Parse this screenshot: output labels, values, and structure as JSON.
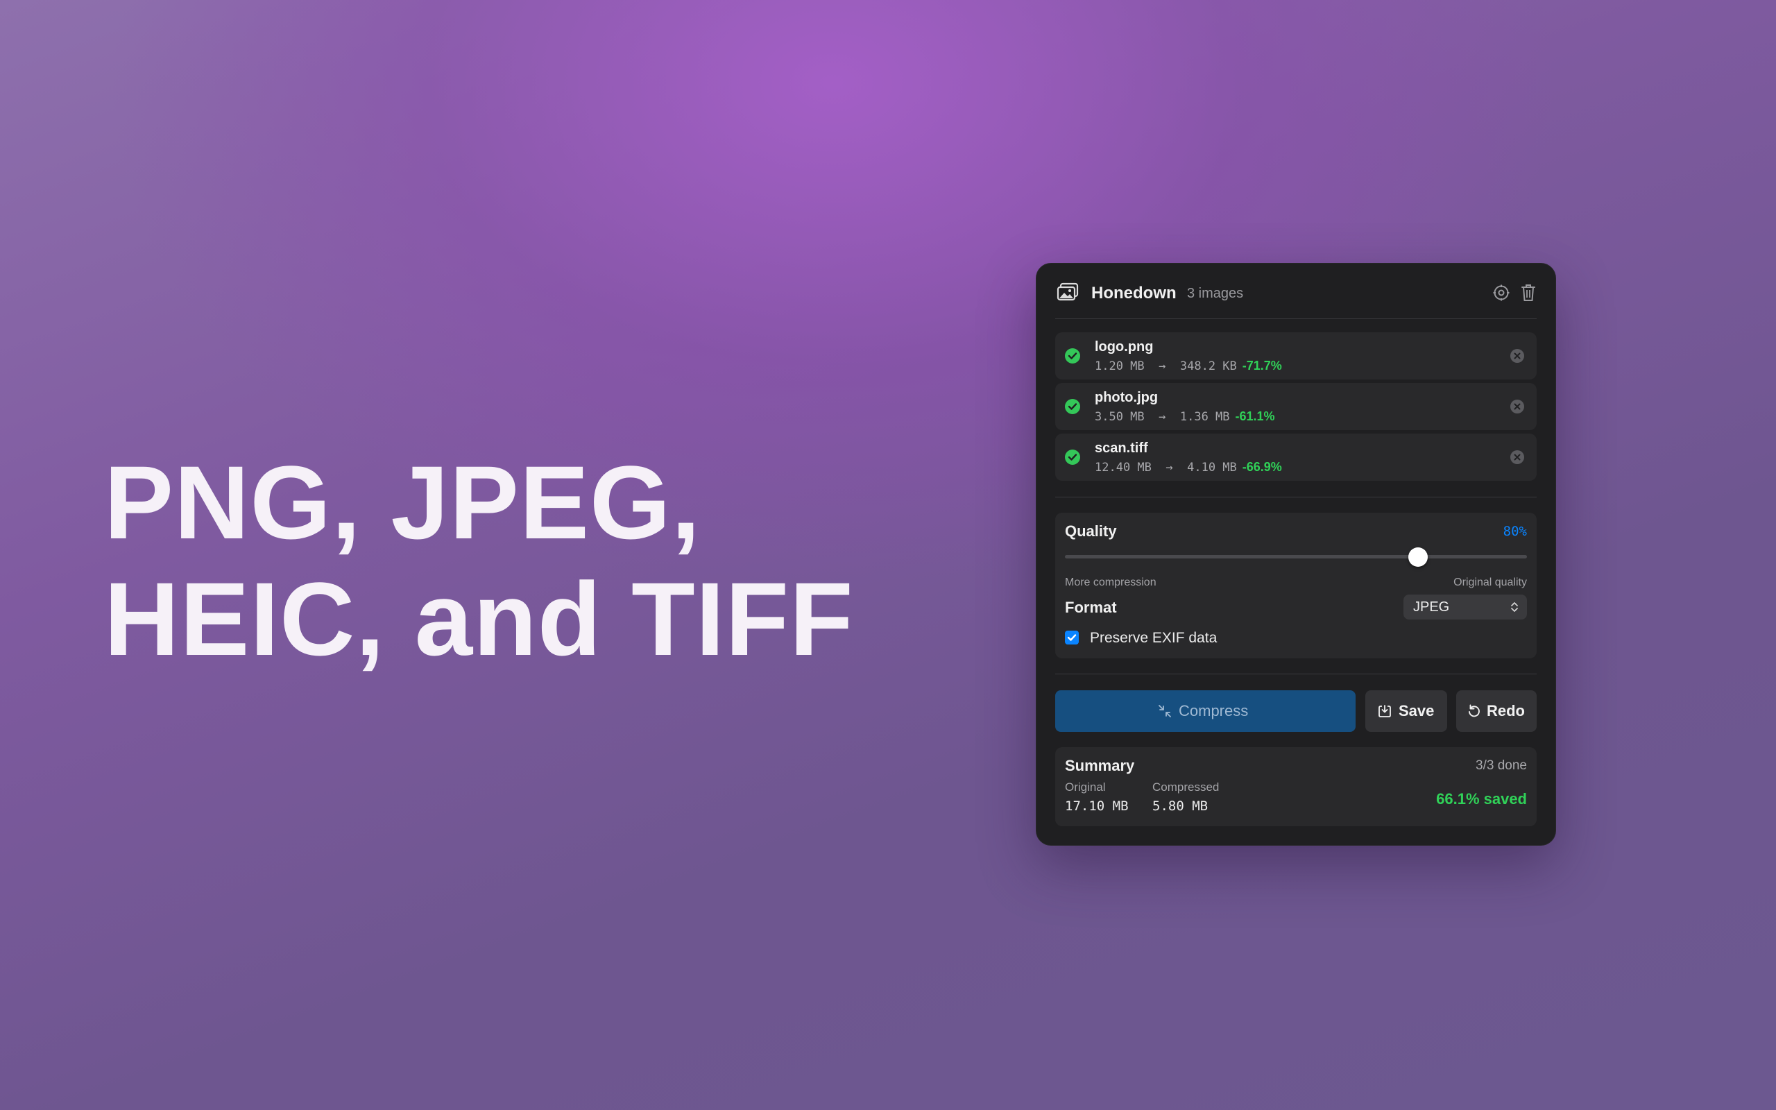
{
  "hero": {
    "line1": "PNG, JPEG,",
    "line2": "HEIC, and TIFF"
  },
  "app": {
    "title": "Honedown",
    "image_count": "3 images",
    "icons": {
      "app": "photos-icon",
      "settings": "gear-icon",
      "clear": "trash-icon"
    }
  },
  "files": [
    {
      "name": "logo.png",
      "original": "1.20 MB",
      "arrow": "→",
      "compressed": "348.2 KB",
      "reduction": "-71.7%"
    },
    {
      "name": "photo.jpg",
      "original": "3.50 MB",
      "arrow": "→",
      "compressed": "1.36 MB",
      "reduction": "-61.1%"
    },
    {
      "name": "scan.tiff",
      "original": "12.40 MB",
      "arrow": "→",
      "compressed": "4.10 MB",
      "reduction": "-66.9%"
    }
  ],
  "settings": {
    "quality_label": "Quality",
    "quality_value": "80%",
    "quality_fraction": 0.765,
    "hint_left": "More compression",
    "hint_right": "Original quality",
    "format_label": "Format",
    "format_value": "JPEG",
    "exif_label": "Preserve EXIF data",
    "exif_checked": true
  },
  "actions": {
    "compress": "Compress",
    "save": "Save",
    "redo": "Redo"
  },
  "summary": {
    "title": "Summary",
    "status": "3/3 done",
    "original_label": "Original",
    "original_value": "17.10 MB",
    "compressed_label": "Compressed",
    "compressed_value": "5.80 MB",
    "saved": "66.1% saved"
  },
  "colors": {
    "accent_blue": "#0a84ff",
    "success_green": "#30d158",
    "compress_button": "#164f80",
    "panel_bg": "#1f1f21"
  }
}
